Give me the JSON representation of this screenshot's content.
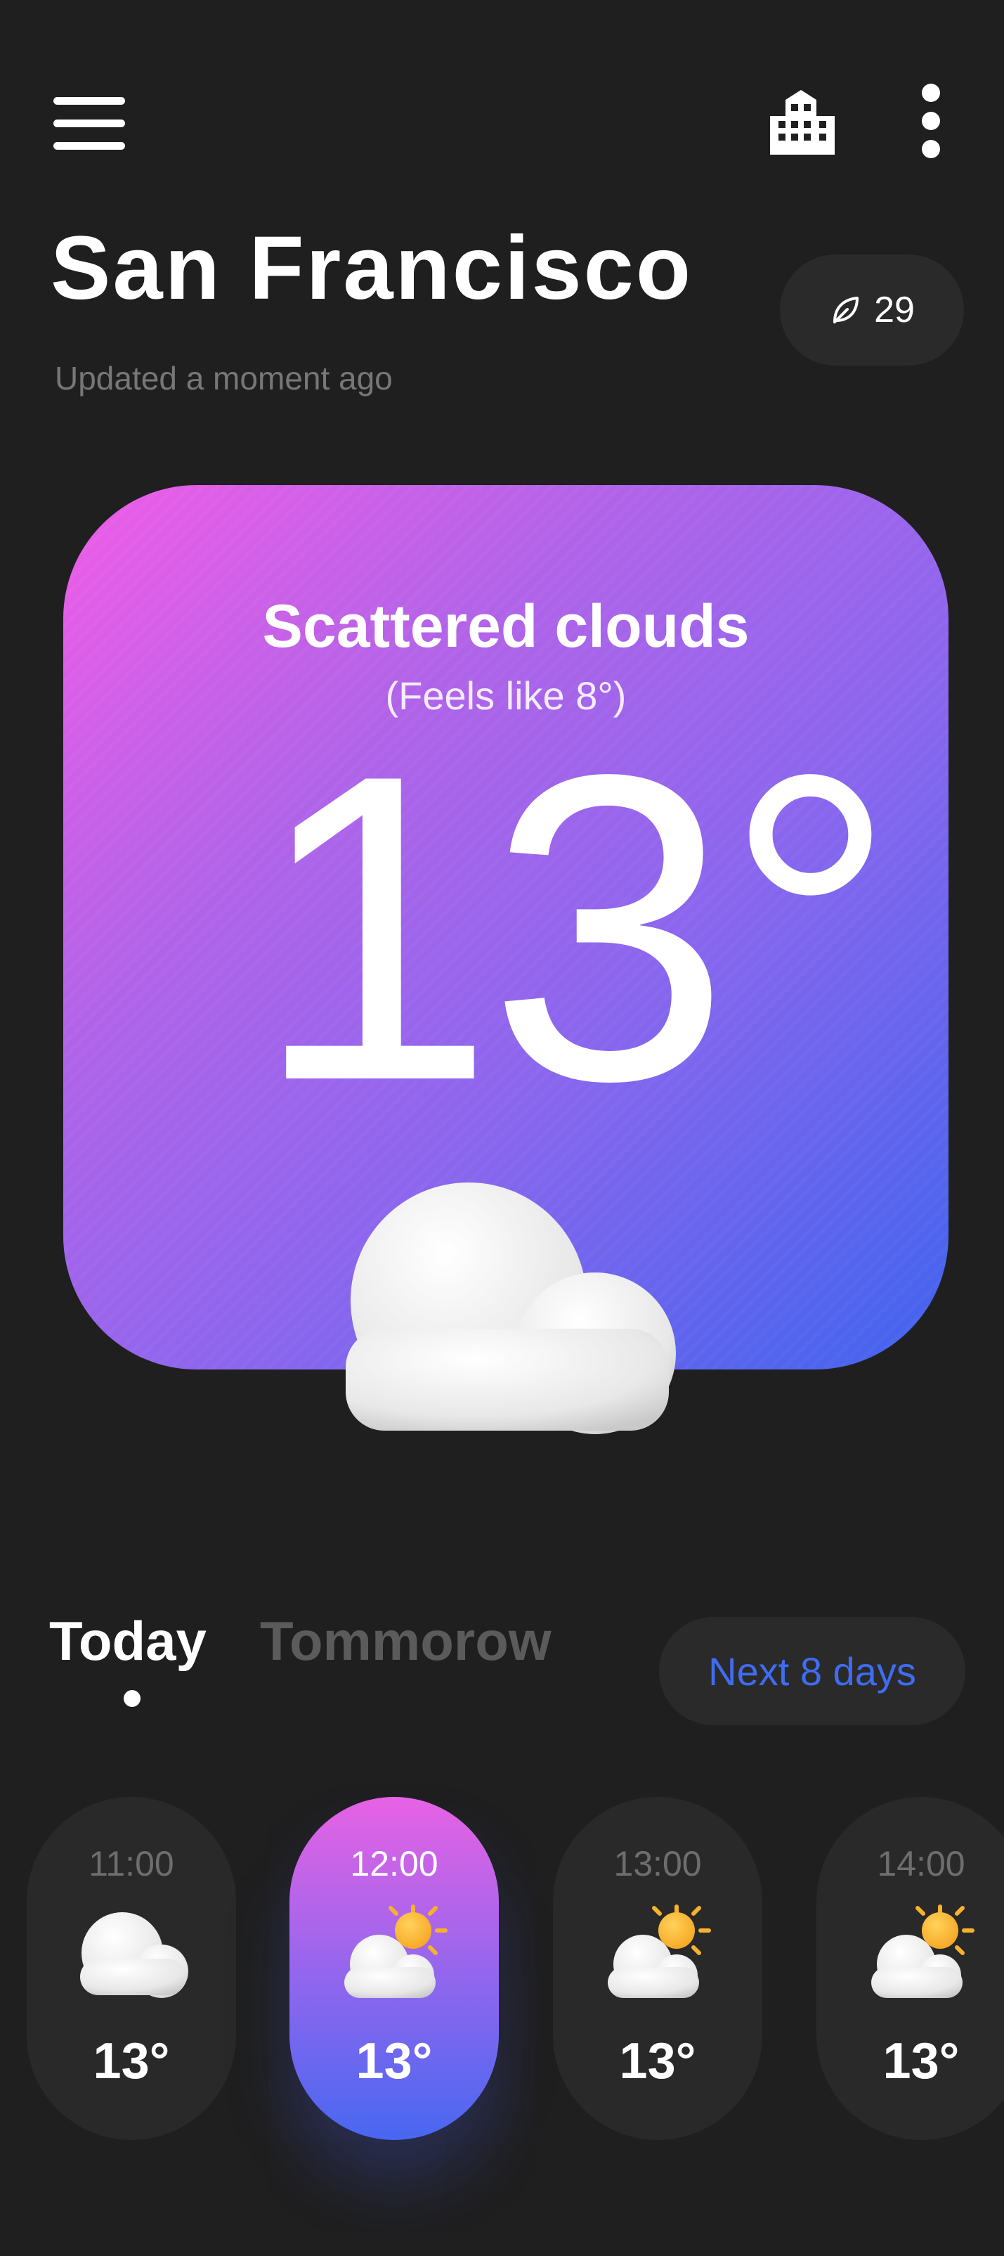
{
  "header": {
    "city": "San Francisco",
    "updated": "Updated a moment ago",
    "aqi": {
      "value": "29",
      "icon": "leaf-icon"
    }
  },
  "toolbar": {
    "menu_icon": "hamburger-menu-icon",
    "city_icon": "city-buildings-icon",
    "more_icon": "more-vertical-icon"
  },
  "current": {
    "condition": "Scattered clouds",
    "feels_like": "(Feels like 8°)",
    "temperature": "13°",
    "icon": "cloud-icon",
    "gradient": [
      "#f05ce8",
      "#8b66ee",
      "#3f63ee"
    ]
  },
  "tabs": {
    "today": "Today",
    "tomorrow": "Tommorow",
    "next_days": "Next 8 days",
    "active": "Today"
  },
  "hourly": [
    {
      "time": "11:00",
      "temp": "13°",
      "icon": "cloud-icon",
      "active": false
    },
    {
      "time": "12:00",
      "temp": "13°",
      "icon": "partly-cloudy-sun-icon",
      "active": true
    },
    {
      "time": "13:00",
      "temp": "13°",
      "icon": "partly-cloudy-sun-icon",
      "active": false
    },
    {
      "time": "14:00",
      "temp": "13°",
      "icon": "partly-cloudy-sun-icon",
      "active": false
    }
  ],
  "colors": {
    "background": "#1f1f1f",
    "surface": "#2a2a2a",
    "accent_blue": "#3f6cf2",
    "muted_text": "#777777"
  }
}
